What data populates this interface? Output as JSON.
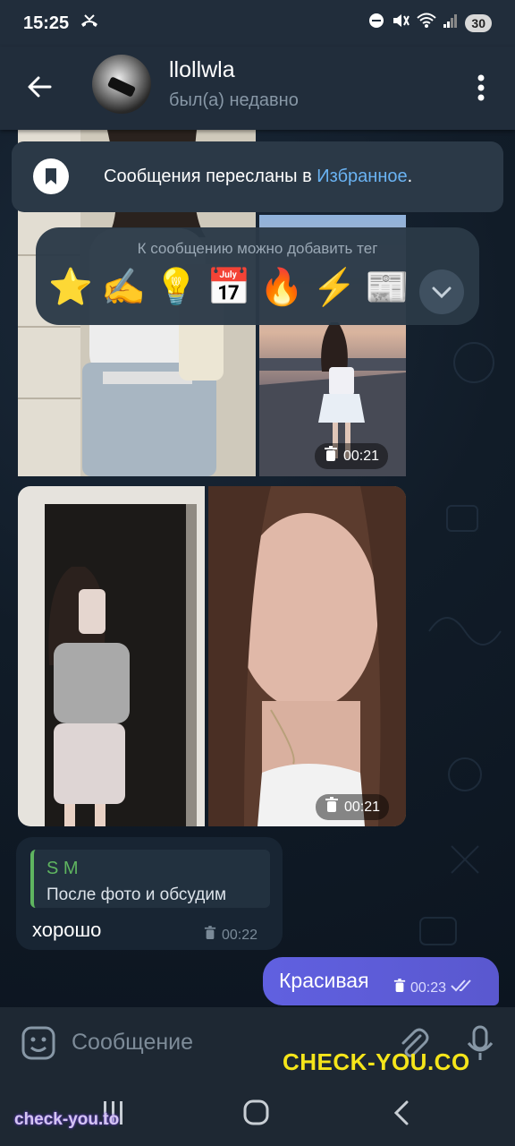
{
  "status_bar": {
    "time": "15:25",
    "battery": "30"
  },
  "header": {
    "name": "llollwla",
    "status": "был(а) недавно"
  },
  "toast": {
    "text": "Сообщения пересланы в ",
    "link": "Избранное",
    "suffix": "."
  },
  "reactions": {
    "hint": "К сообщению можно добавить тег",
    "items": [
      "⭐",
      "✍️",
      "💡",
      "📅",
      "🔥",
      "⚡",
      "📰"
    ]
  },
  "photos": {
    "group1_time": "00:21",
    "group2_time": "00:21"
  },
  "messages": {
    "reply": {
      "quote_author": "S M",
      "quote_text": "После фото и обсудим",
      "text": "хорошо",
      "time": "00:22"
    },
    "outgoing": {
      "text": "Красивая",
      "time": "00:23"
    }
  },
  "input": {
    "placeholder": "Сообщение"
  },
  "watermarks": {
    "main": "CHECK-YOU.CO",
    "corner": "check-you.to"
  },
  "colors": {
    "header_bg": "#212d3b",
    "accent_link": "#6ab3f3",
    "outgoing_bubble": "#5a5ad6",
    "quote_bar": "#5fb560",
    "watermark_yellow": "#f5e51a"
  }
}
